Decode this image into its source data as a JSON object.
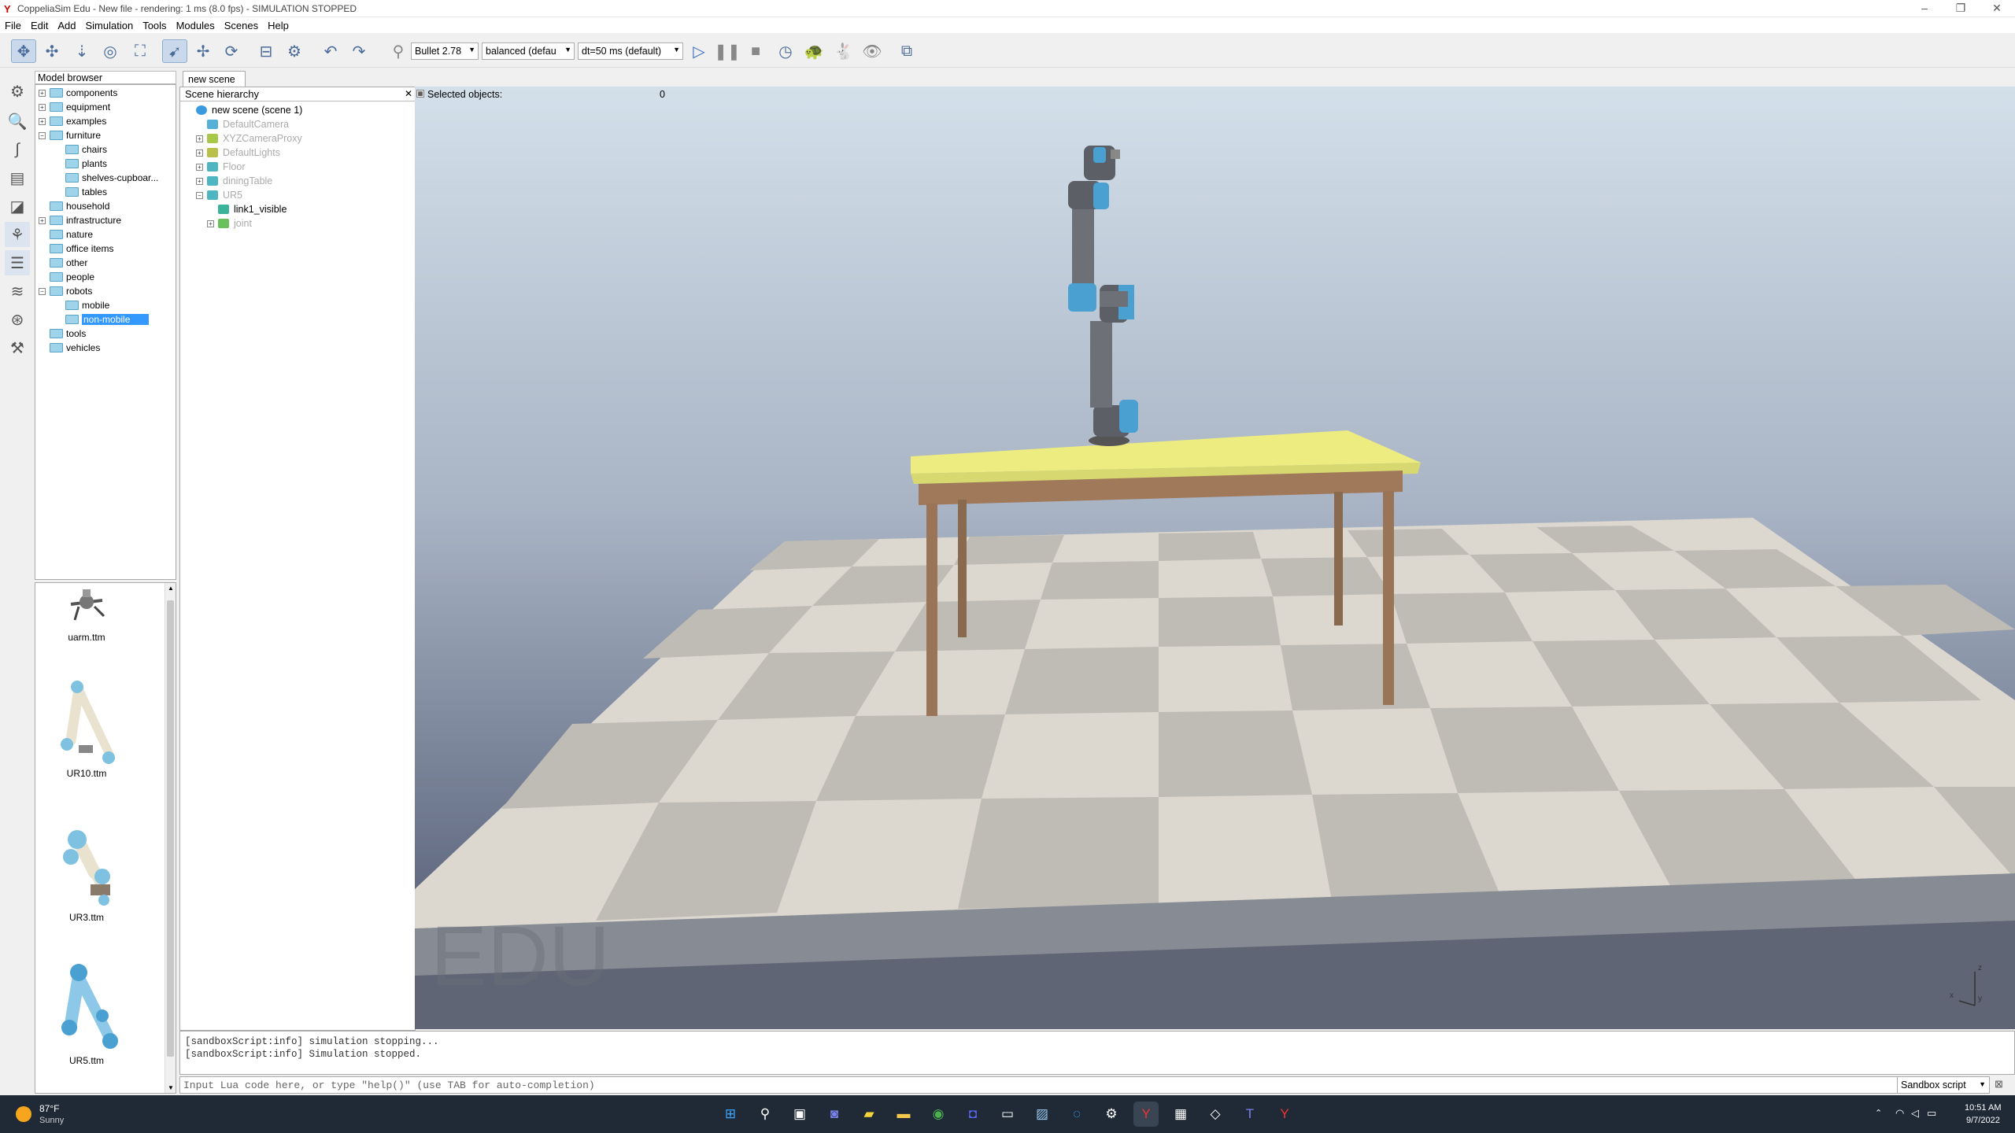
{
  "window": {
    "title": "CoppeliaSim Edu - New file - rendering: 1 ms (8.0 fps) - SIMULATION STOPPED",
    "app_icon": "coppeliasim-icon"
  },
  "menu": [
    "File",
    "Edit",
    "Add",
    "Simulation",
    "Tools",
    "Modules",
    "Scenes",
    "Help"
  ],
  "toolbar": {
    "engine": "Bullet 2.78",
    "accuracy": "balanced (defau",
    "timestep": "dt=50 ms (default)"
  },
  "model_browser": {
    "title": "Model browser",
    "items": [
      {
        "label": "components",
        "expander": "+"
      },
      {
        "label": "equipment",
        "expander": "+"
      },
      {
        "label": "examples",
        "expander": "+"
      },
      {
        "label": "furniture",
        "expander": "-"
      },
      {
        "label": "chairs",
        "expander": ""
      },
      {
        "label": "plants",
        "expander": ""
      },
      {
        "label": "shelves-cupboar...",
        "expander": ""
      },
      {
        "label": "tables",
        "expander": ""
      },
      {
        "label": "household",
        "expander": ""
      },
      {
        "label": "infrastructure",
        "expander": "+"
      },
      {
        "label": "nature",
        "expander": ""
      },
      {
        "label": "office items",
        "expander": ""
      },
      {
        "label": "other",
        "expander": ""
      },
      {
        "label": "people",
        "expander": ""
      },
      {
        "label": "robots",
        "expander": "-"
      },
      {
        "label": "mobile",
        "expander": ""
      },
      {
        "label": "non-mobile",
        "expander": ""
      },
      {
        "label": "tools",
        "expander": ""
      },
      {
        "label": "vehicles",
        "expander": ""
      }
    ],
    "selected": "non-mobile",
    "thumbnails": [
      "uarm.ttm",
      "UR10.ttm",
      "UR3.ttm",
      "UR5.ttm"
    ]
  },
  "scene_tab": "new scene",
  "hierarchy": {
    "title": "Scene hierarchy",
    "items": [
      {
        "label": "new scene (scene 1)",
        "expander": ""
      },
      {
        "label": "DefaultCamera",
        "expander": ""
      },
      {
        "label": "XYZCameraProxy",
        "expander": "+"
      },
      {
        "label": "DefaultLights",
        "expander": "+"
      },
      {
        "label": "Floor",
        "expander": "+"
      },
      {
        "label": "diningTable",
        "expander": "+"
      },
      {
        "label": "UR5",
        "expander": "-"
      },
      {
        "label": "link1_visible",
        "expander": ""
      },
      {
        "label": "joint",
        "expander": "+"
      }
    ]
  },
  "viewport": {
    "selected_label": "Selected objects:",
    "selected_count": "0",
    "watermark": "EDU",
    "axis_labels": [
      "z",
      "y",
      "x"
    ]
  },
  "console": {
    "lines": [
      "[sandboxScript:info] simulation stopping...",
      "[sandboxScript:info] Simulation stopped."
    ]
  },
  "lua_input": {
    "placeholder": "Input Lua code here, or type \"help()\" (use TAB for auto-completion)"
  },
  "script_selector": "Sandbox script",
  "taskbar": {
    "weather_temp": "87°F",
    "weather_cond": "Sunny",
    "time": "10:51 AM",
    "date": "9/7/2022"
  },
  "colors": {
    "selection": "#3399ff",
    "taskbar": "#1f2a36",
    "table_top": "#ecec80",
    "table_leg": "#a0785a"
  }
}
